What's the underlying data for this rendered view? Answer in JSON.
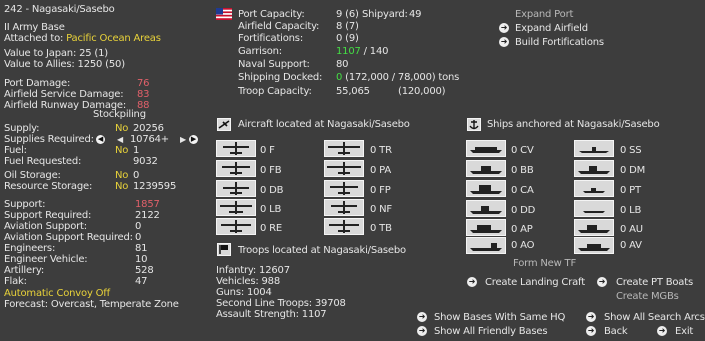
{
  "base": {
    "title": "242 - Nagasaki/Sasebo",
    "type": "II Army Base",
    "attached_label": "Attached to:",
    "attached_value": "Pacific Ocean Areas",
    "value_japan": "Value to Japan: 25 (1)",
    "value_allies": "Value to Allies: 1250 (50)"
  },
  "damage": {
    "port_label": "Port Damage:",
    "port_value": "76",
    "airfield_service_label": "Airfield Service Damage:",
    "airfield_service_value": "83",
    "airfield_runway_label": "Airfield Runway Damage:",
    "airfield_runway_value": "88"
  },
  "supply": {
    "stockpiling_label": "Stockpiling",
    "supply_label": "Supply:",
    "supply_stockpile": "No",
    "supply_value": "20256",
    "required_label": "Supplies Required:",
    "required_value": "10764+",
    "fuel_label": "Fuel:",
    "fuel_stockpile": "No",
    "fuel_value": "1",
    "fuel_requested_label": "Fuel Requested:",
    "fuel_requested_value": "9032",
    "oil_label": "Oil Storage:",
    "oil_stockpile": "No",
    "oil_value": "0",
    "resource_label": "Resource Storage:",
    "resource_stockpile": "No",
    "resource_value": "1239595"
  },
  "support": {
    "support_label": "Support:",
    "support_value": "1857",
    "support_required_label": "Support Required:",
    "support_required_value": "2122",
    "aviation_label": "Aviation Support:",
    "aviation_value": "0",
    "aviation_required_label": "Aviation Support Required:",
    "aviation_required_value": "0",
    "engineers_label": "Engineers:",
    "engineers_value": "81",
    "engineer_vehicle_label": "Engineer Vehicle:",
    "engineer_vehicle_value": "10",
    "artillery_label": "Artillery:",
    "artillery_value": "528",
    "flak_label": "Flak:",
    "flak_value": "47",
    "convoy": "Automatic Convoy Off",
    "forecast": "Forecast: Overcast, Temperate Zone"
  },
  "capacity": {
    "port_label": "Port Capacity:",
    "port_value": "9 (6)",
    "shipyard_label": "Shipyard:",
    "shipyard_value": "49",
    "airfield_label": "Airfield Capacity:",
    "airfield_value": "8 (7)",
    "fort_label": "Fortifications:",
    "fort_value": "0 (9)",
    "garrison_label": "Garrison:",
    "garrison_value": "1107",
    "garrison_total": "/ 140",
    "naval_label": "Naval Support:",
    "naval_value": "80",
    "shipping_label": "Shipping Docked:",
    "shipping_value": "0",
    "shipping_detail": "(172,000 / 78,000) tons",
    "troop_label": "Troop Capacity:",
    "troop_value": "55,065",
    "troop_detail": "(120,000)"
  },
  "actions_top": {
    "expand_port": "Expand Port",
    "expand_airfield": "Expand Airfield",
    "build_fortifications": "Build Fortifications"
  },
  "aircraft": {
    "heading": "Aircraft located at Nagasaki/Sasebo",
    "left": [
      {
        "count": "0",
        "code": "F"
      },
      {
        "count": "0",
        "code": "FB"
      },
      {
        "count": "0",
        "code": "DB"
      },
      {
        "count": "0",
        "code": "LB"
      },
      {
        "count": "0",
        "code": "RE"
      }
    ],
    "right": [
      {
        "count": "0",
        "code": "TR"
      },
      {
        "count": "0",
        "code": "PA"
      },
      {
        "count": "0",
        "code": "FP"
      },
      {
        "count": "0",
        "code": "NF"
      },
      {
        "count": "0",
        "code": "TB"
      }
    ]
  },
  "ships": {
    "heading": "Ships anchored at Nagasaki/Sasebo",
    "left": [
      {
        "count": "0",
        "code": "CV"
      },
      {
        "count": "0",
        "code": "BB"
      },
      {
        "count": "0",
        "code": "CA"
      },
      {
        "count": "0",
        "code": "DD"
      },
      {
        "count": "0",
        "code": "AP"
      },
      {
        "count": "0",
        "code": "AO"
      }
    ],
    "right": [
      {
        "count": "0",
        "code": "SS"
      },
      {
        "count": "0",
        "code": "DM"
      },
      {
        "count": "0",
        "code": "PT"
      },
      {
        "count": "0",
        "code": "LB"
      },
      {
        "count": "0",
        "code": "AU"
      },
      {
        "count": "0",
        "code": "AV"
      }
    ],
    "form_tf": "Form New TF",
    "create_landing": "Create Landing Craft",
    "create_pt": "Create PT Boats",
    "create_mgb": "Create MGBs"
  },
  "troops": {
    "heading": "Troops located at Nagasaki/Sasebo",
    "infantry": "Infantry: 12607",
    "vehicles": "Vehicles: 988",
    "guns": "Guns: 1004",
    "second_line": "Second Line Troops: 39708",
    "assault": "Assault Strength: 1107"
  },
  "bottom_actions": {
    "same_hq": "Show Bases With Same HQ",
    "friendly": "Show All Friendly Bases",
    "search_arcs": "Show All Search Arcs",
    "back": "Back",
    "exit": "Exit"
  }
}
